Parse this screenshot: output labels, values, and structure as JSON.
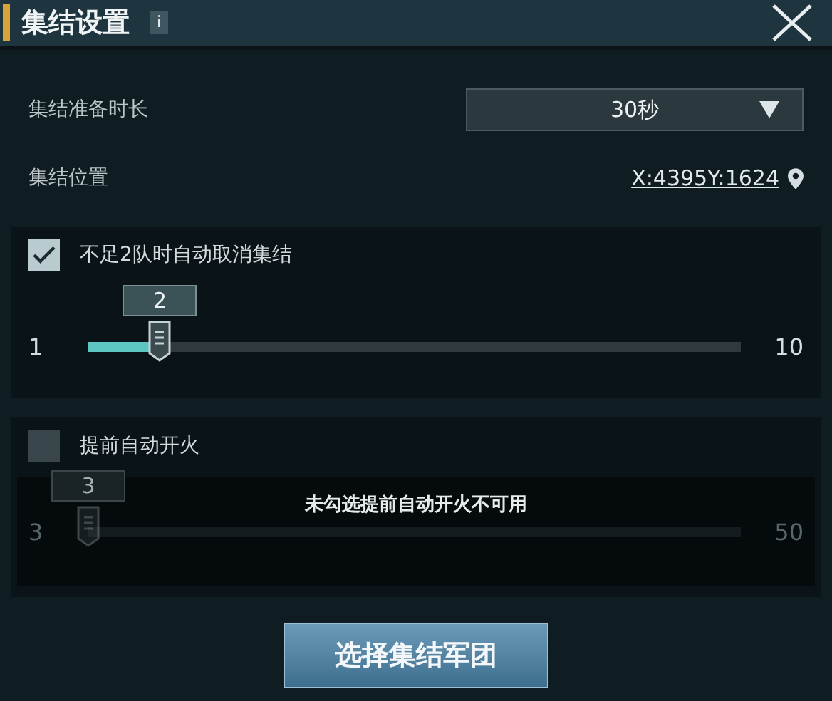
{
  "window": {
    "title": "集结设置",
    "info": "i"
  },
  "settings": [
    {
      "kind": "dropdown",
      "label": "集结准备时长",
      "value": "30秒"
    },
    {
      "kind": "location",
      "label": "集结位置",
      "value": "X:4395Y:1624"
    }
  ],
  "options": [
    {
      "label": "不足2队时自动取消集结",
      "checked": true,
      "slider": {
        "min": "1",
        "max": "10",
        "value": "2",
        "level": 0.11
      }
    },
    {
      "label": "提前自动开火",
      "checked": false,
      "slider": {
        "min": "3",
        "max": "50",
        "value": "3",
        "level": 0
      },
      "note": "未勾选提前自动开火不可用"
    }
  ],
  "button": "选择集结军团"
}
